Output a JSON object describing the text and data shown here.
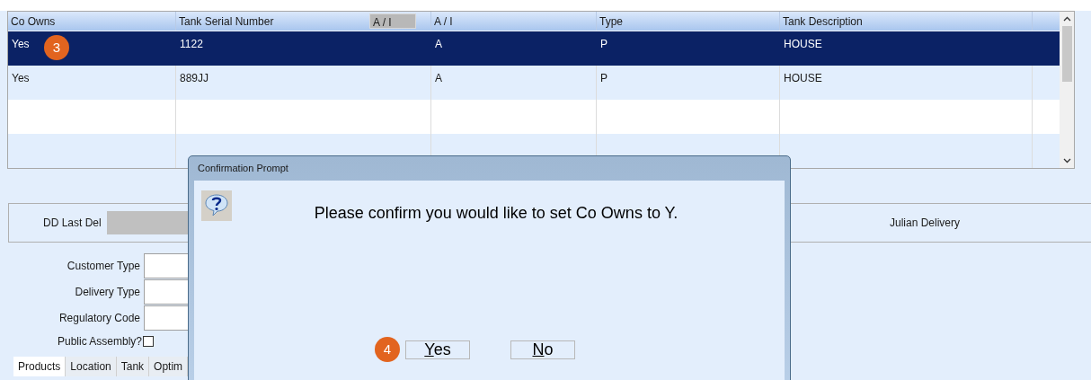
{
  "table": {
    "columns": [
      {
        "label": "Co Owns"
      },
      {
        "label": "Tank Serial Number",
        "tag": "A / I"
      },
      {
        "label": "A / I"
      },
      {
        "label": "Type"
      },
      {
        "label": "Tank Description"
      }
    ],
    "rows": [
      {
        "selected": true,
        "badge": "3",
        "cells": [
          "Yes",
          "1122",
          "A",
          "P",
          "HOUSE"
        ]
      },
      {
        "selected": false,
        "cells": [
          "Yes",
          "889JJ",
          "A",
          "P",
          "HOUSE"
        ]
      }
    ]
  },
  "delivery_panel": {
    "last_delivery": {
      "label": "DD Last Del"
    },
    "julian_delivery": {
      "label": "Julian Delivery"
    }
  },
  "form": {
    "fields": [
      {
        "label": "Customer Type"
      },
      {
        "label": "Delivery Type"
      },
      {
        "label": "Regulatory Code"
      }
    ],
    "public_assembly": {
      "label": "Public Assembly?",
      "checked": false
    }
  },
  "tabs": [
    {
      "label": "Products",
      "selected": true
    },
    {
      "label": "Location",
      "selected": false
    },
    {
      "label": "Tank",
      "selected": false
    },
    {
      "label": "Optim",
      "selected": false
    }
  ],
  "dialog": {
    "title": "Confirmation Prompt",
    "message": "Please confirm you would like to set Co Owns to Y.",
    "buttons": [
      {
        "label": "Yes",
        "badge": "4"
      },
      {
        "label": "No"
      }
    ]
  }
}
